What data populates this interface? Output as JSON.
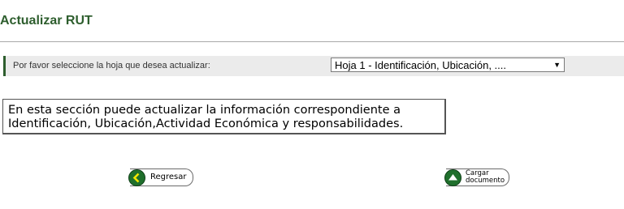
{
  "page": {
    "title": "Actualizar RUT"
  },
  "form": {
    "prompt": "Por favor seleccione la hoja que desea actualizar:",
    "sheet_select": {
      "selected": "Hoja 1 - Identificación, Ubicación, ...."
    }
  },
  "info": {
    "line1": "En esta sección puede actualizar la información correspondiente a",
    "line2": "Identificación, Ubicación,Actividad Económica y responsabilidades."
  },
  "buttons": {
    "back_label": "Regresar",
    "upload_label_line1": "Cargar",
    "upload_label_line2": "documento"
  },
  "colors": {
    "title": "#2e5e2e",
    "accent": "#2e5e2e",
    "button_icon": "#1f6f2c"
  },
  "icons": {
    "back": "arrow-left-icon",
    "upload": "arrow-up-icon",
    "dropdown": "caret-down-icon"
  }
}
